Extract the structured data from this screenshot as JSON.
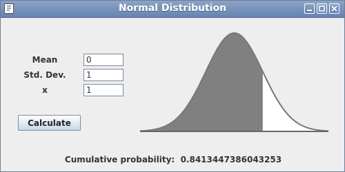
{
  "window": {
    "title": "Normal Distribution",
    "icons": {
      "app": "java-app-icon",
      "minimize": "minimize-icon",
      "maximize": "maximize-icon",
      "close": "close-icon"
    }
  },
  "form": {
    "mean_label": "Mean",
    "mean_value": "0",
    "std_label": "Std. Dev.",
    "std_value": "1",
    "x_label": "x",
    "x_value": "1",
    "calculate_label": "Calculate"
  },
  "result": {
    "label": "Cumulative probability:",
    "value": "0.8413447386043253"
  },
  "chart_data": {
    "type": "area",
    "mean": 0,
    "std_dev": 1,
    "x": 1,
    "x_range": [
      -3.3,
      3.3
    ],
    "shaded_region": "left of x",
    "colors": {
      "shaded": "#808080",
      "unshaded": "#ffffff",
      "curve": "#777777",
      "baseline": "#666666"
    }
  }
}
